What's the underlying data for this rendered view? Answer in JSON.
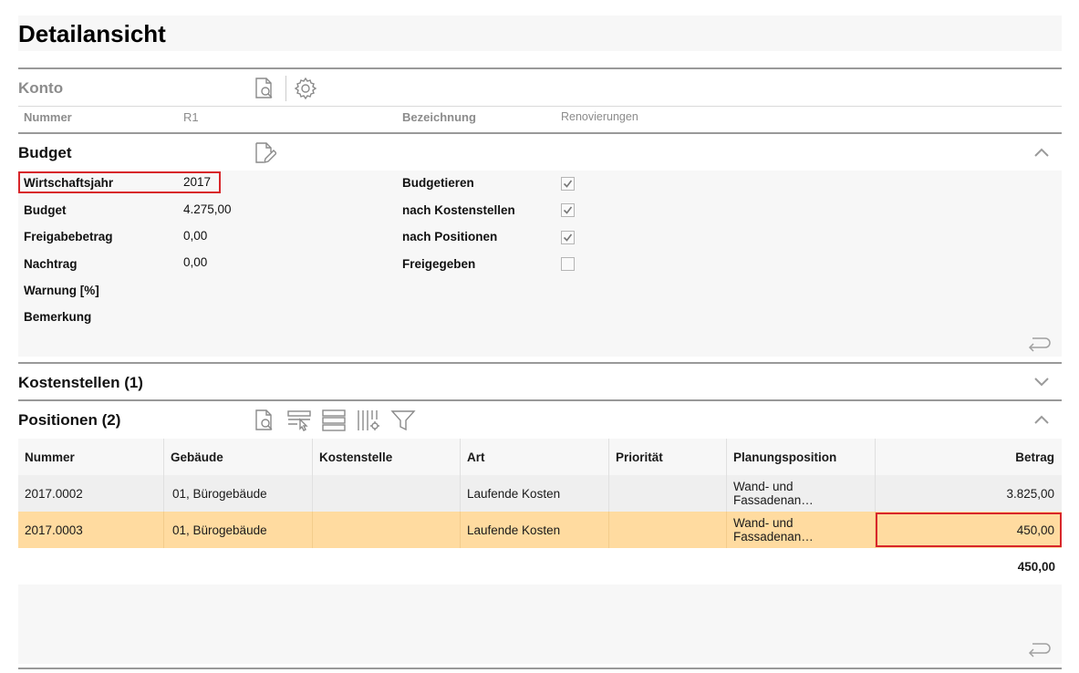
{
  "page": {
    "title": "Detailansicht"
  },
  "konto": {
    "title": "Konto",
    "nummer_label": "Nummer",
    "nummer_value": "R1",
    "bezeichnung_label": "Bezeichnung",
    "bezeichnung_value": "Renovierungen"
  },
  "budget": {
    "title": "Budget",
    "fields": {
      "wirtschaftsjahr_label": "Wirtschaftsjahr",
      "wirtschaftsjahr_value": "2017",
      "budget_label": "Budget",
      "budget_value": "4.275,00",
      "freigabebetrag_label": "Freigabebetrag",
      "freigabebetrag_value": "0,00",
      "nachtrag_label": "Nachtrag",
      "nachtrag_value": "0,00",
      "warnung_label": "Warnung [%]",
      "bemerkung_label": "Bemerkung"
    },
    "checks": {
      "budgetieren_label": "Budgetieren",
      "budgetieren_checked": true,
      "kostenstellen_label": "nach Kostenstellen",
      "kostenstellen_checked": true,
      "positionen_label": "nach Positionen",
      "positionen_checked": true,
      "freigegeben_label": "Freigegeben",
      "freigegeben_checked": false
    }
  },
  "kostenstellen": {
    "title": "Kostenstellen (1)"
  },
  "positionen": {
    "title": "Positionen (2)",
    "columns": [
      "Nummer",
      "Gebäude",
      "Kostenstelle",
      "Art",
      "Priorität",
      "Planungsposition",
      "Betrag"
    ],
    "rows": [
      [
        "2017.0002",
        "01, Bürogebäude",
        "",
        "Laufende Kosten",
        "",
        "Wand- und Fassadenan…",
        "3.825,00"
      ],
      [
        "2017.0003",
        "01, Bürogebäude",
        "",
        "Laufende Kosten",
        "",
        "Wand- und Fassadenan…",
        "450,00"
      ]
    ],
    "selected_row": 1,
    "total": "450,00"
  },
  "colors": {
    "highlight": "#d8262a",
    "selected_row": "#ffdba0",
    "panel_bg": "#f7f7f7"
  }
}
